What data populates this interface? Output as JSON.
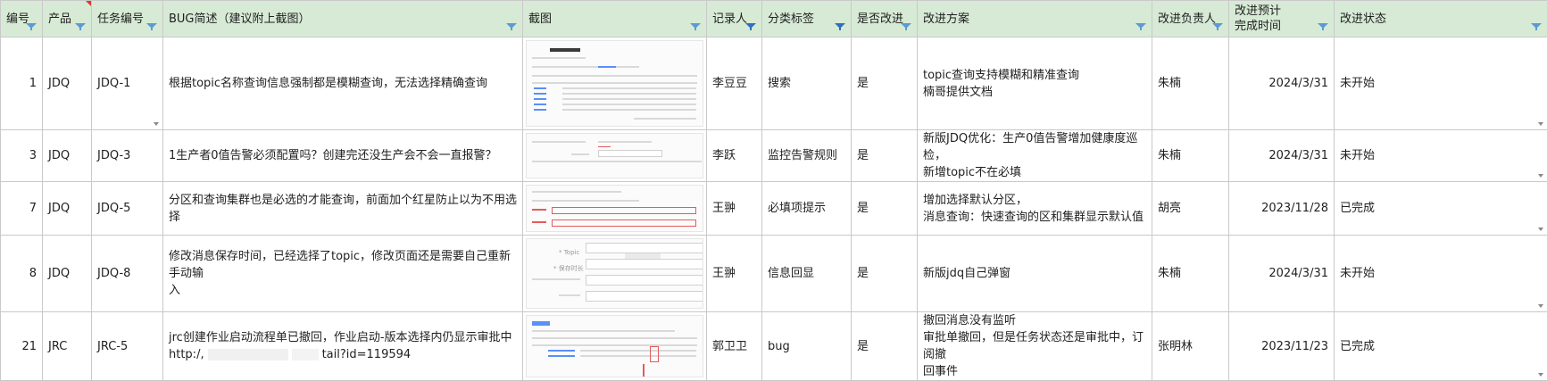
{
  "columns": [
    {
      "key": "no",
      "label": "编号"
    },
    {
      "key": "product",
      "label": "产品"
    },
    {
      "key": "task",
      "label": "任务编号"
    },
    {
      "key": "desc",
      "label": "BUG简述（建议附上截图）"
    },
    {
      "key": "shot",
      "label": "截图"
    },
    {
      "key": "recorder",
      "label": "记录人"
    },
    {
      "key": "category",
      "label": "分类标签"
    },
    {
      "key": "improve",
      "label": "是否改进"
    },
    {
      "key": "plan",
      "label": "改进方案"
    },
    {
      "key": "owner",
      "label": "改进负责人"
    },
    {
      "key": "eta",
      "label_line1": "改进预计",
      "label_line2": "完成时间"
    },
    {
      "key": "status",
      "label": "改进状态"
    }
  ],
  "rows": [
    {
      "no": "1",
      "product": "JDQ",
      "task": "JDQ-1",
      "desc": "根据topic名称查询信息强制都是模糊查询，无法选择精确查询",
      "recorder": "李豆豆",
      "category": "搜索",
      "improve": "是",
      "plan_line1": "topic查询支持模糊和精准查询",
      "plan_line2": "楠哥提供文档",
      "owner": "朱楠",
      "eta": "2024/3/31",
      "status": "未开始"
    },
    {
      "no": "3",
      "product": "JDQ",
      "task": "JDQ-3",
      "desc": "1生产者0值告警必须配置吗？创建完还没生产会不会一直报警？",
      "recorder": "李跃",
      "category": "监控告警规则",
      "improve": "是",
      "plan_line1": "新版JDQ优化：生产0值告警增加健康度巡检，",
      "plan_line2": "新增topic不在必填",
      "owner": "朱楠",
      "eta": "2024/3/31",
      "status": "未开始"
    },
    {
      "no": "7",
      "product": "JDQ",
      "task": "JDQ-5",
      "desc": "分区和查询集群也是必选的才能查询，前面加个红星防止以为不用选择",
      "recorder": "王翀",
      "category": "必填项提示",
      "improve": "是",
      "plan_line1": "增加选择默认分区，",
      "plan_line2": "消息查询：快速查询的区和集群显示默认值",
      "owner": "胡亮",
      "eta": "2023/11/28",
      "status": "已完成"
    },
    {
      "no": "8",
      "product": "JDQ",
      "task": "JDQ-8",
      "desc_line1": "修改消息保存时间，已经选择了topic，修改页面还是需要自己重新手动输",
      "desc_line2": "入",
      "recorder": "王翀",
      "category": "信息回显",
      "improve": "是",
      "plan_line1": "新版jdq自己弹窗",
      "plan_line2": "",
      "owner": "朱楠",
      "eta": "2024/3/31",
      "status": "未开始"
    },
    {
      "no": "21",
      "product": "JRC",
      "task": "JRC-5",
      "desc_line1": "jrc创建作业启动流程单已撤回，作业启动-版本选择内仍显示审批中",
      "desc_line2": "http:/,",
      "desc_line2b": "tail?id=119594",
      "recorder": "郭卫卫",
      "category": "bug",
      "improve": "是",
      "plan_line1": "撤回消息没有监听",
      "plan_line2": "审批单撤回，但是任务状态还是审批中，订阅撤",
      "plan_line3": "回事件",
      "owner": "张明林",
      "eta": "2023/11/23",
      "status": "已完成"
    }
  ],
  "screenshot_texts": {
    "r4_topic": "* Topic",
    "r4_field": "* 保存时长"
  },
  "colors": {
    "header_bg": "#d7ead6",
    "grid": "#c9c9c9",
    "filter_icon": "#5b9bd5"
  }
}
